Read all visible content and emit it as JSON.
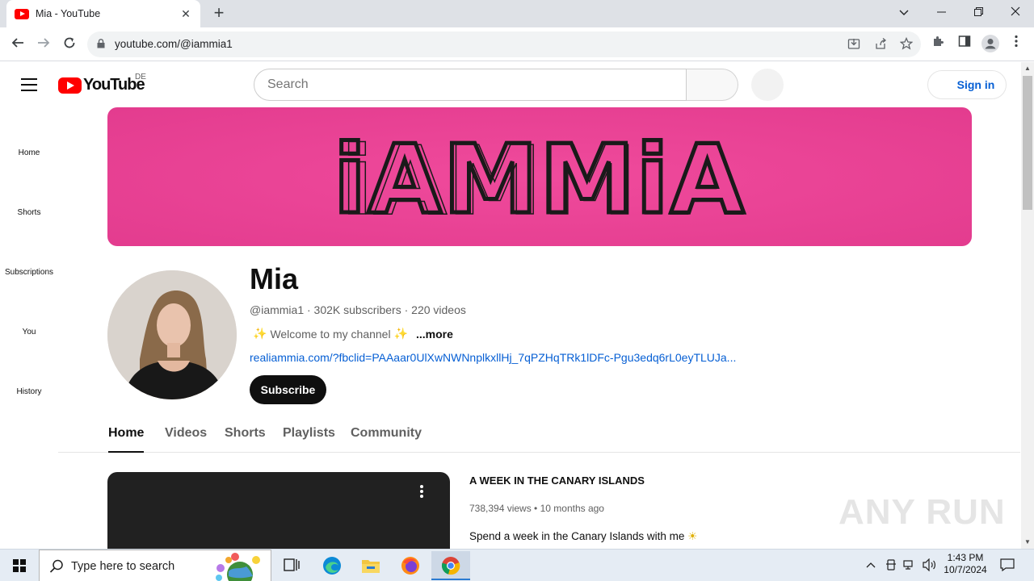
{
  "browser": {
    "tab_title": "Mia - YouTube",
    "tab_close": "✕",
    "new_tab": "+",
    "url": "youtube.com/@iammia1"
  },
  "youtube": {
    "logo_text": "YouTube",
    "country_code": "DE",
    "search_placeholder": "Search",
    "sign_in_label": "Sign in"
  },
  "sidebar": {
    "items": [
      {
        "label": "Home"
      },
      {
        "label": "Shorts"
      },
      {
        "label": "Subscriptions"
      },
      {
        "label": "You"
      },
      {
        "label": "History"
      }
    ]
  },
  "channel": {
    "banner_text": "iAMMiA",
    "banner_color": "#ef3f96",
    "name": "Mia",
    "handle_meta": "@iammia1 · 302K subscribers · 220 videos",
    "description": "Welcome to my channel",
    "more_label": "...more",
    "link": "realiammia.com/?fbclid=PAAaar0UlXwNWNnplkxllHj_7qPZHqTRk1lDFc-Pgu3edq6rL0eyTLUJa...",
    "subscribe_label": "Subscribe"
  },
  "channel_tabs": [
    {
      "label": "Home",
      "active": true
    },
    {
      "label": "Videos",
      "active": false
    },
    {
      "label": "Shorts",
      "active": false
    },
    {
      "label": "Playlists",
      "active": false
    },
    {
      "label": "Community",
      "active": false
    }
  ],
  "featured_video": {
    "title": "A WEEK IN THE CANARY ISLANDS",
    "meta": "738,394 views • 10 months ago",
    "description": "Spend a week in the Canary Islands with me"
  },
  "watermark": "ANY RUN",
  "taskbar": {
    "search_placeholder": "Type here to search",
    "time": "1:43 PM",
    "date": "10/7/2024"
  }
}
